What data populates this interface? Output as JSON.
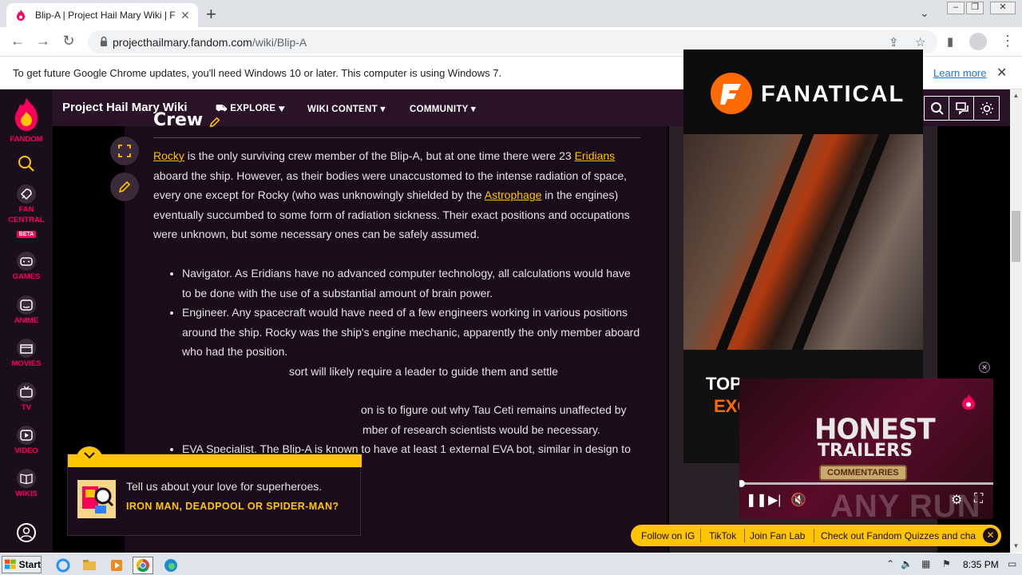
{
  "browser": {
    "tab_title": "Blip-A | Project Hail Mary Wiki | Fand",
    "tab_close": "✕",
    "new_tab": "+",
    "url_host": "projecthailmary.fandom.com",
    "url_path": "/wiki/Blip-A"
  },
  "infobar": {
    "message": "To get future Google Chrome updates, you'll need Windows 10 or later. This computer is using Windows 7.",
    "link": "Learn more",
    "close": "✕"
  },
  "rail": {
    "fandom": "FANDOM",
    "fan_central_1": "FAN",
    "fan_central_2": "CENTRAL",
    "beta": "BETA",
    "games": "GAMES",
    "anime": "ANIME",
    "movies": "MOVIES",
    "tv": "TV",
    "video": "VIDEO",
    "wikis": "WIKIS"
  },
  "header": {
    "wiki_name": "Project Hail Mary Wiki",
    "explore": "EXPLORE",
    "wiki_content": "WIKI CONTENT",
    "community": "COMMUNITY"
  },
  "article": {
    "section_title": "Crew",
    "p1_link1": "Rocky",
    "p1_t1": " is the only surviving crew member of the Blip-A, but at one time there were 23 ",
    "p1_link2": "Eridians",
    "p1_t2": " aboard the ship. However, as their bodies were unaccustomed to the intense radiation of space, every one except for Rocky (who was unknowingly shielded by the ",
    "p1_link3": "Astrophage",
    "p1_t3": " in the engines) eventually succumbed to some form of radiation sickness. Their exact positions and occupations were unknown, but some necessary ones can be safely assumed.",
    "bullets": [
      "Navigator. As Eridians have no advanced computer technology, all calculations would have to be done with the use of a substantial amount of brain power.",
      "Engineer. Any spacecraft would have need of a few engineers working in various positions around the ship. Rocky was the ship's engine mechanic, apparently the only member aboard who had the position.",
      "sort will likely require a leader to guide them and settle",
      "on is to figure out why Tau Ceti remains unaffected by",
      "mber of research scientists would be necessary.",
      "EVA Specialist. The Blip-A is known to have at least 1 external EVA bot, similar in design to"
    ]
  },
  "ad": {
    "brand": "FANATICAL",
    "headline1": "TOP",
    "headline2": "EXC"
  },
  "video": {
    "title1": "HONEST",
    "title2": "TRAILERS",
    "badge": "COMMENTARIES",
    "progress": 0.0
  },
  "notification": {
    "question": "Tell us about your love for superheroes.",
    "answer": "IRON MAN, DEADPOOL OR SPIDER-MAN?"
  },
  "pillbar": {
    "items": [
      "Follow on IG",
      "TikTok",
      "Join Fan Lab",
      "Check out Fandom Quizzes and cha"
    ]
  },
  "watermark": "ANY RUN",
  "taskbar": {
    "start": "Start",
    "time": "8:35 PM"
  },
  "colors": {
    "fandom_pink": "#fa005a",
    "link_yellow": "#ffc500",
    "page_bg": "#1a0c1a"
  }
}
